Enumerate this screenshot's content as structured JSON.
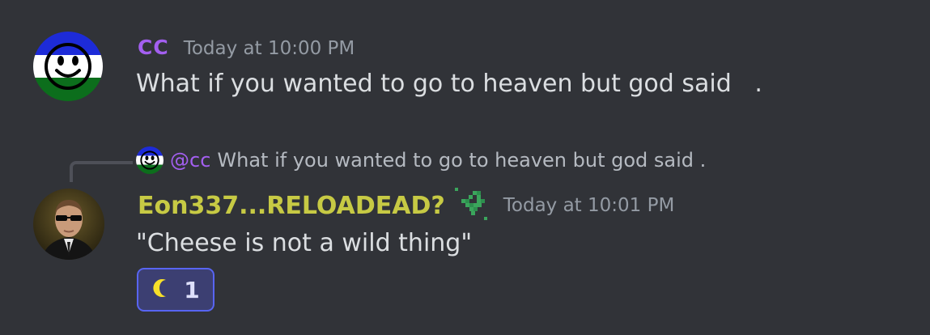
{
  "messages": [
    {
      "author": "CC",
      "timestamp": "Today at 10:00 PM",
      "text": "What if you wanted to go to heaven but god said   .",
      "avatar_icon": "smiley-flag-avatar"
    },
    {
      "author": "Eon337...RELOADEAD?",
      "timestamp": "Today at 10:01 PM",
      "text": "\"Cheese is not a wild thing\"",
      "avatar_icon": "agent-smith-avatar",
      "badge_icon": "pixel-sprout-icon",
      "reply": {
        "mention": "@cc",
        "text": "What if you wanted to go to heaven but god said ."
      },
      "reactions": [
        {
          "emoji": "crescent-moon-icon",
          "count": "1"
        }
      ]
    }
  ],
  "colors": {
    "background": "#313338",
    "cc_name": "#a35ff0",
    "eon_name": "#c7ca44",
    "reaction_bg": "#3c3f72",
    "reaction_border": "#5865f2"
  }
}
